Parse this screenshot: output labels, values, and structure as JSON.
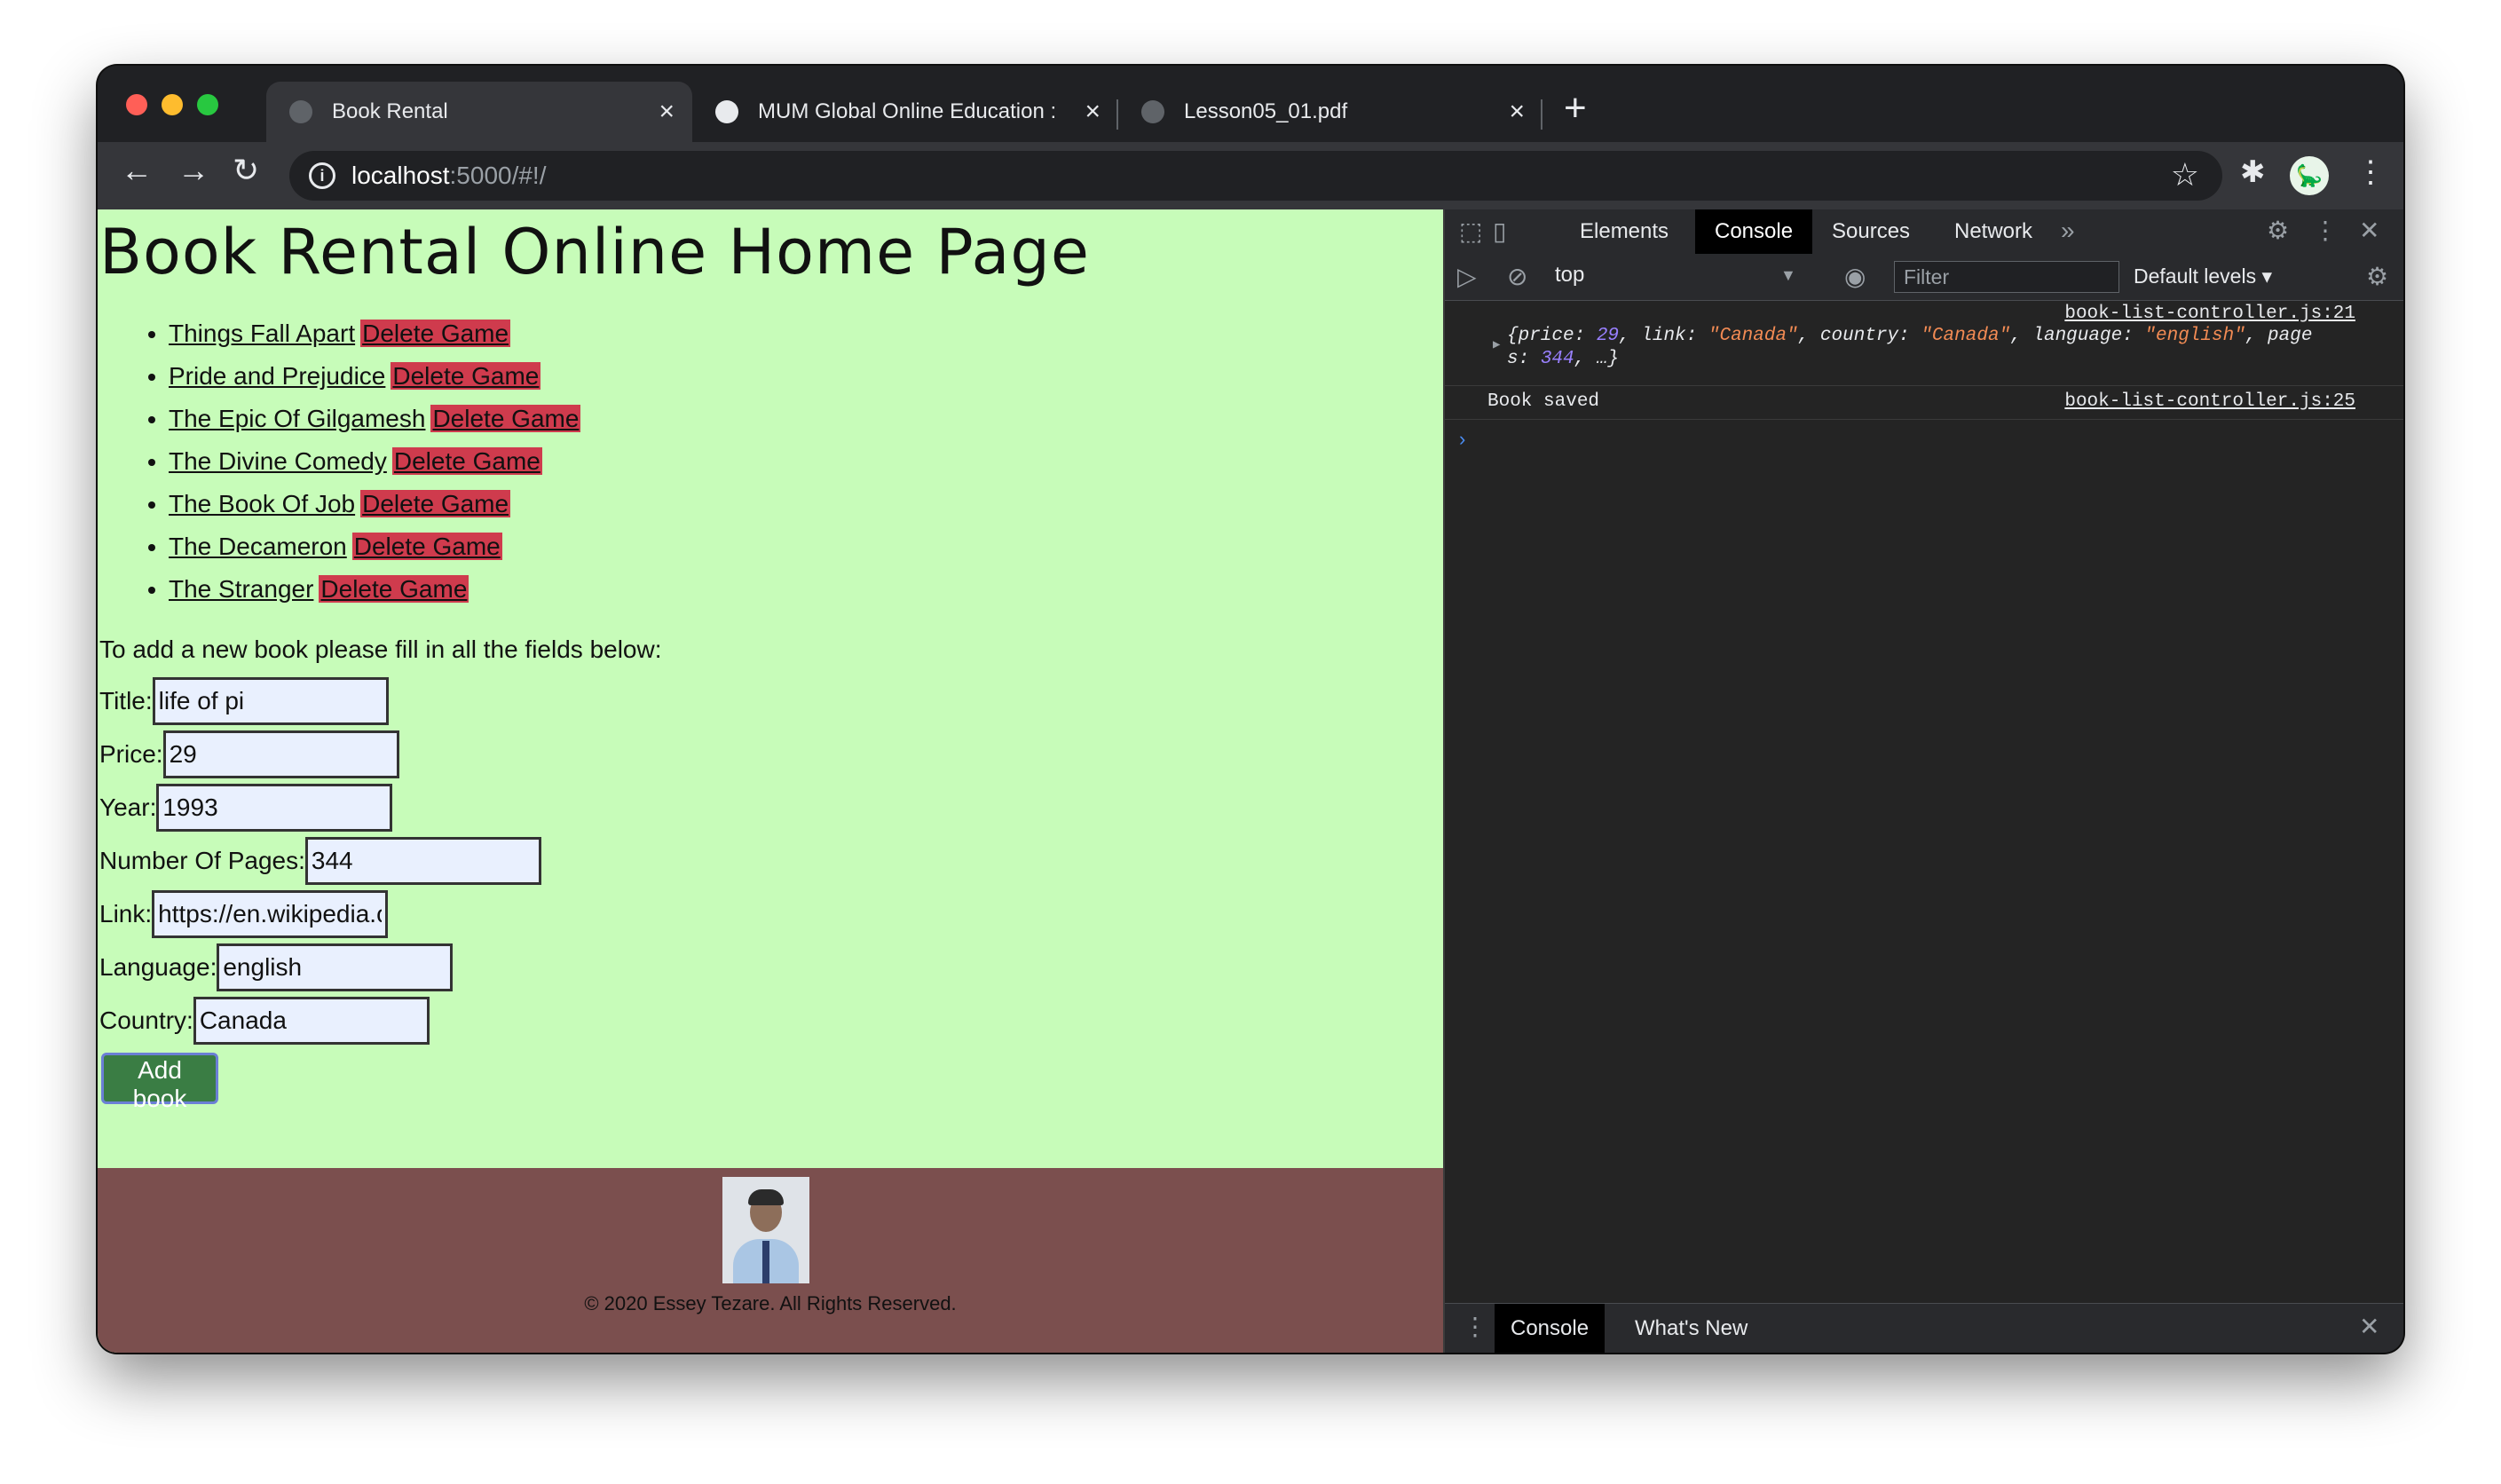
{
  "browser": {
    "tabs": [
      {
        "title": "Book Rental"
      },
      {
        "title": "MUM Global Online Education :"
      },
      {
        "title": "Lesson05_01.pdf"
      }
    ],
    "close_glyph": "×",
    "new_tab_glyph": "+",
    "url_host": "localhost",
    "url_rest": ":5000/#!/",
    "icons": {
      "back": "←",
      "forward": "→",
      "reload": "↻",
      "star": "☆",
      "extensions": "✱",
      "menu": "⋮",
      "info": "i",
      "profile": "🦕"
    }
  },
  "page": {
    "heading": "Book Rental Online Home Page",
    "books": [
      {
        "title": "Things Fall Apart",
        "delete_label": "Delete Game"
      },
      {
        "title": "Pride and Prejudice",
        "delete_label": "Delete Game"
      },
      {
        "title": "The Epic Of Gilgamesh",
        "delete_label": "Delete Game"
      },
      {
        "title": "The Divine Comedy",
        "delete_label": "Delete Game"
      },
      {
        "title": "The Book Of Job",
        "delete_label": "Delete Game"
      },
      {
        "title": "The Decameron",
        "delete_label": "Delete Game"
      },
      {
        "title": "The Stranger",
        "delete_label": "Delete Game"
      }
    ],
    "form_intro": "To add a new book please fill in all the fields below:",
    "fields": {
      "title": {
        "label": "Title:",
        "value": "life of pi"
      },
      "price": {
        "label": "Price:",
        "value": "29"
      },
      "year": {
        "label": "Year:",
        "value": "1993"
      },
      "pages": {
        "label": "Number Of Pages:",
        "value": "344"
      },
      "link": {
        "label": "Link:",
        "value": "https://en.wikipedia.or"
      },
      "language": {
        "label": "Language:",
        "value": "english"
      },
      "country": {
        "label": "Country:",
        "value": "Canada"
      }
    },
    "add_button": "Add book",
    "footer": {
      "copyright": "© 2020 Essey Tezare. All Rights Reserved."
    }
  },
  "devtools": {
    "tabs": [
      "Elements",
      "Console",
      "Sources",
      "Network"
    ],
    "more_tabs": "»",
    "context": "top",
    "filter_placeholder": "Filter",
    "levels": "Default levels ▾",
    "icons": {
      "inspect": "⬚",
      "device": "▯",
      "settings": "⚙",
      "more": "⋮",
      "close": "✕",
      "sidebar": "▷",
      "clear": "⊘",
      "eye": "◉"
    },
    "log": [
      {
        "source": "book-list-controller.js:21",
        "line1_pre": "{price: ",
        "price": "29",
        "line1_mid1": ", link: ",
        "link": "\"Canada\"",
        "line1_mid2": ", country: ",
        "country": "\"Canada\"",
        "line1_mid3": ", language: ",
        "language": "\"english\"",
        "line1_end": ", page",
        "line2_pre": "s: ",
        "pages": "344",
        "line2_end": ", …}"
      },
      {
        "text": "Book saved",
        "source": "book-list-controller.js:25"
      }
    ],
    "prompt": "›",
    "drawer_tabs": [
      "Console",
      "What's New"
    ],
    "drawer_menu": "⋮",
    "drawer_close": "✕"
  },
  "colors": {
    "page_bg": "#c7fcb9",
    "delete_bg": "#cf3b4d",
    "add_button_bg": "#3a7d44",
    "footer_bg": "#7b4f4e",
    "input_bg": "#e9f0fe"
  }
}
